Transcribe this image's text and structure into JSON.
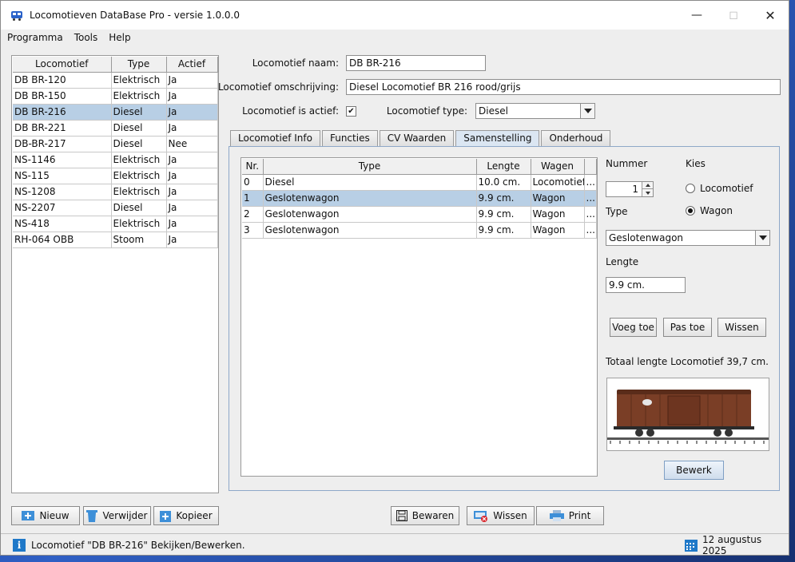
{
  "window": {
    "title": "Locomotieven DataBase Pro - versie 1.0.0.0"
  },
  "menu": [
    "Programma",
    "Tools",
    "Help"
  ],
  "list": {
    "headers": [
      "Locomotief",
      "Type",
      "Actief"
    ],
    "rows": [
      [
        "DB BR-120",
        "Elektrisch",
        "Ja"
      ],
      [
        "DB BR-150",
        "Elektrisch",
        "Ja"
      ],
      [
        "DB BR-216",
        "Diesel",
        "Ja"
      ],
      [
        "DB BR-221",
        "Diesel",
        "Ja"
      ],
      [
        "DB-BR-217",
        "Diesel",
        "Nee"
      ],
      [
        "NS-1146",
        "Elektrisch",
        "Ja"
      ],
      [
        "NS-115",
        "Elektrisch",
        "Ja"
      ],
      [
        "NS-1208",
        "Elektrisch",
        "Ja"
      ],
      [
        "NS-2207",
        "Diesel",
        "Ja"
      ],
      [
        "NS-418",
        "Elektrisch",
        "Ja"
      ],
      [
        "RH-064 OBB",
        "Stoom",
        "Ja"
      ]
    ],
    "selected_index": 2
  },
  "form": {
    "name_label": "Locomotief naam:",
    "name_value": "DB BR-216",
    "desc_label": "Locomotief omschrijving:",
    "desc_value": "Diesel Locomotief BR 216 rood/grijs",
    "active_label": "Locomotief is actief:",
    "active_check": "✔",
    "type_label": "Locomotief type:",
    "type_value": "Diesel"
  },
  "tabs": [
    "Locomotief Info",
    "Functies",
    "CV Waarden",
    "Samenstelling",
    "Onderhoud"
  ],
  "active_tab": 3,
  "composition": {
    "headers": [
      "Nr.",
      "Type",
      "Lengte",
      "Wagen",
      ""
    ],
    "rows": [
      [
        "0",
        "Diesel",
        "10.0 cm.",
        "Locomotief",
        "..."
      ],
      [
        "1",
        "Geslotenwagon",
        "9.9 cm.",
        "Wagon",
        "..."
      ],
      [
        "2",
        "Geslotenwagon",
        "9.9 cm.",
        "Wagon",
        "..."
      ],
      [
        "3",
        "Geslotenwagon",
        "9.9 cm.",
        "Wagon",
        "..."
      ]
    ],
    "selected_index": 1
  },
  "side": {
    "nummer_label": "Nummer",
    "nummer_value": "1",
    "kies_label": "Kies",
    "radio_loco": "Locomotief",
    "radio_wagon": "Wagon",
    "type_label": "Type",
    "type_value": "Geslotenwagon",
    "lengte_label": "Lengte",
    "lengte_value": "9.9 cm.",
    "btn_add": "Voeg toe",
    "btn_edit": "Pas toe",
    "btn_clear": "Wissen",
    "total_text": "Totaal lengte Locomotief 39,7 cm.",
    "btn_bewerk": "Bewerk"
  },
  "bottom": {
    "nieuw": "Nieuw",
    "verwijder": "Verwijder",
    "kopieer": "Kopieer",
    "bewaren": "Bewaren",
    "wissen": "Wissen",
    "print": "Print"
  },
  "status": {
    "message": "Locomotief \"DB BR-216\" Bekijken/Bewerken.",
    "date": "12 augustus 2025"
  },
  "colors": {
    "selection": "#b8cfe5",
    "accent": "#1e78c8",
    "wagon": "#7a3e26"
  }
}
